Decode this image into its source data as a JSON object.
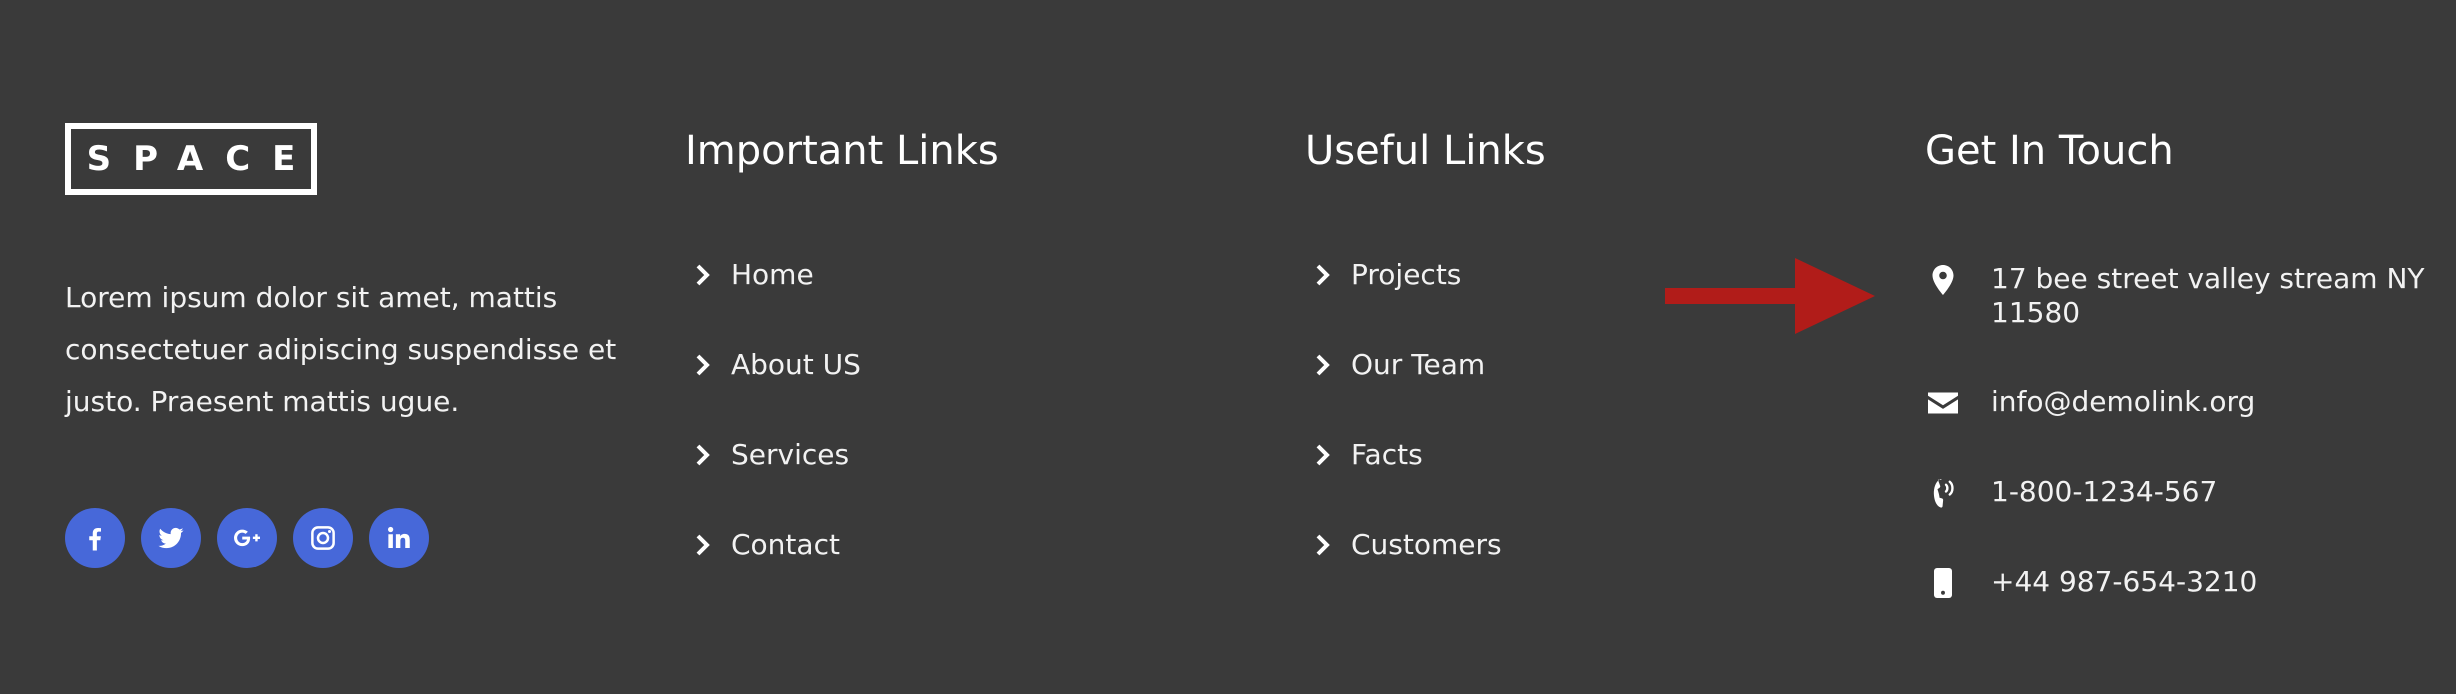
{
  "brand": {
    "logo_text": "SPACE"
  },
  "about": {
    "text": "Lorem ipsum dolor sit amet, mattis consectetuer adipiscing suspendisse et justo. Praesent mattis ugue."
  },
  "socials": [
    {
      "name": "facebook-icon"
    },
    {
      "name": "twitter-icon"
    },
    {
      "name": "google-plus-icon"
    },
    {
      "name": "instagram-icon"
    },
    {
      "name": "linkedin-icon"
    }
  ],
  "important_links": {
    "title": "Important Links",
    "items": [
      "Home",
      "About US",
      "Services",
      "Contact"
    ]
  },
  "useful_links": {
    "title": "Useful Links",
    "items": [
      "Projects",
      "Our Team",
      "Facts",
      "Customers"
    ]
  },
  "contact": {
    "title": "Get In Touch",
    "address": "17 bee street valley stream NY 11580",
    "email": "info@demolink.org",
    "phone": "1-800-1234-567",
    "mobile": "+44 987-654-3210"
  },
  "colors": {
    "background": "#3a3a3a",
    "social_bg": "#4768d9",
    "annotation_arrow": "#b11c19"
  }
}
